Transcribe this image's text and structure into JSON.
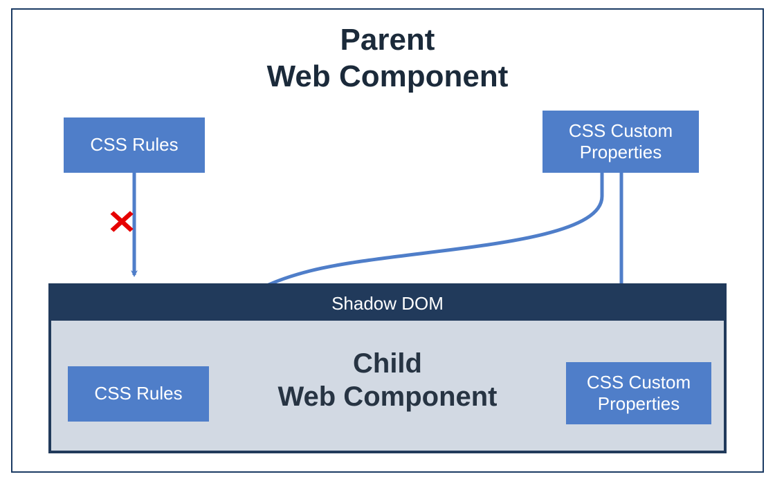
{
  "parent": {
    "title_line1": "Parent",
    "title_line2": "Web Component",
    "boxes": {
      "css_rules": "CSS Rules",
      "css_custom_line1": "CSS Custom",
      "css_custom_line2": "Properties"
    }
  },
  "shadow": {
    "header": "Shadow DOM"
  },
  "child": {
    "title_line1": "Child",
    "title_line2": "Web Component",
    "boxes": {
      "css_rules": "CSS Rules",
      "css_custom_line1": "CSS Custom",
      "css_custom_line2": "Properties"
    }
  },
  "marks": {
    "blocked": "✕"
  },
  "colors": {
    "box_fill": "#4f7ec9",
    "arrow": "#4f7ec9",
    "frame": "#1b3a63",
    "shadow_dark": "#213a5b",
    "child_body": "#d2d9e3",
    "blocked": "#e60000"
  }
}
